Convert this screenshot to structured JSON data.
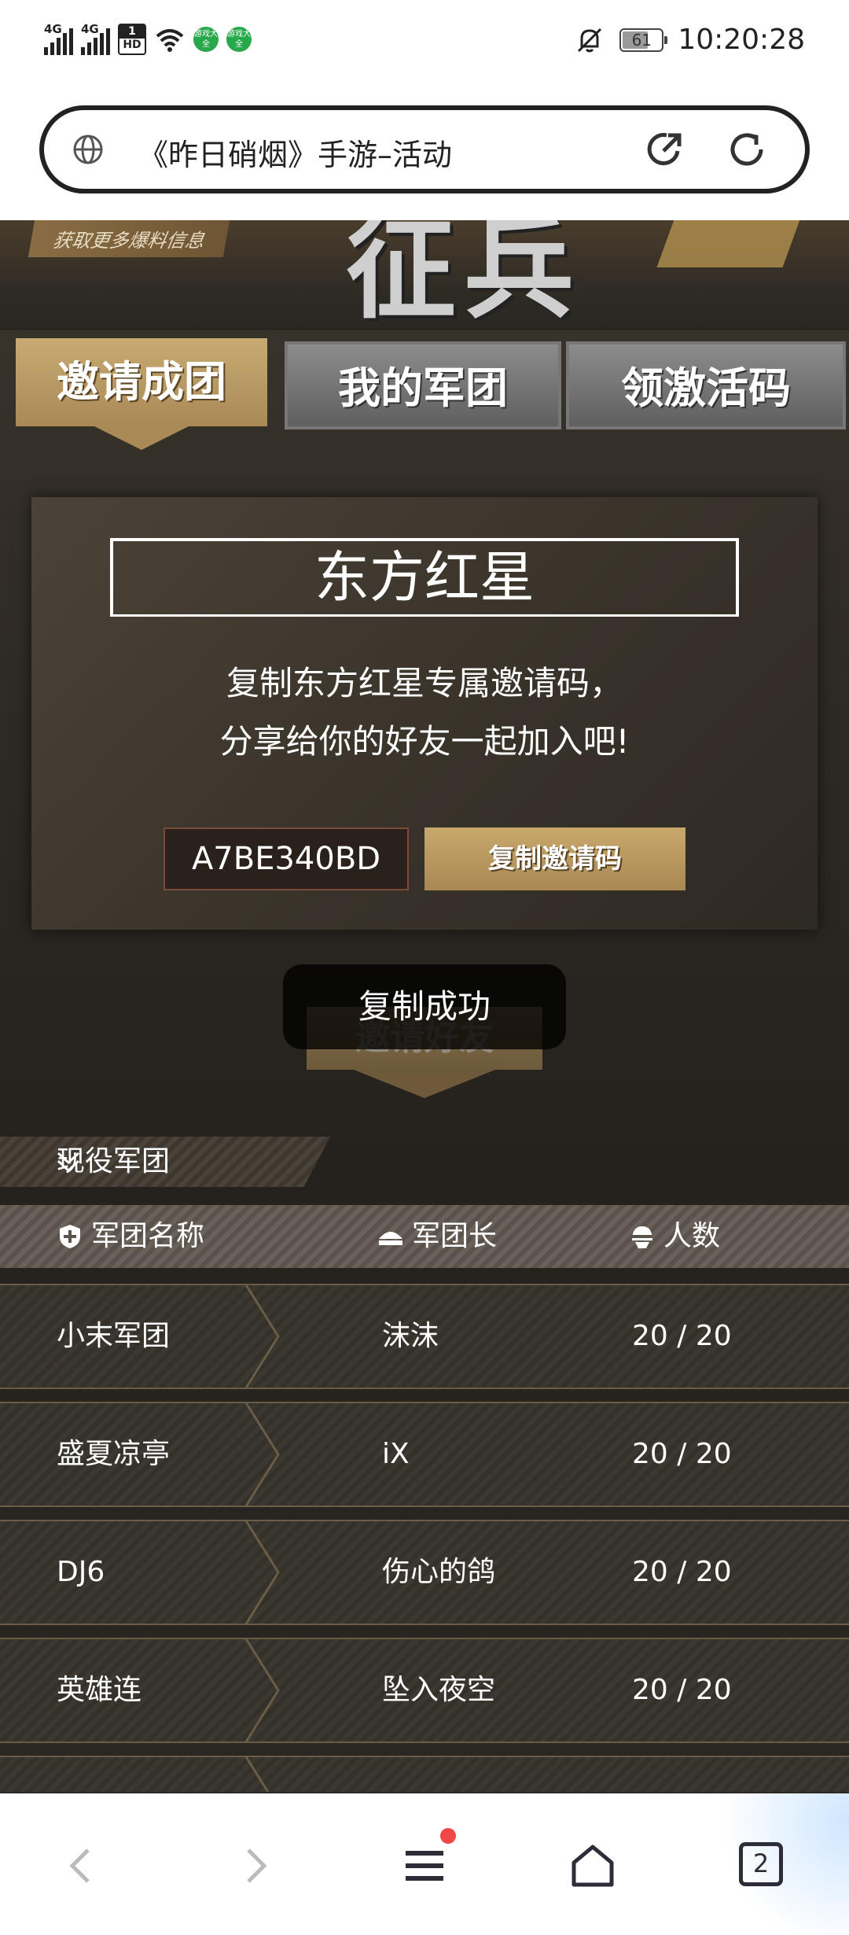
{
  "status_bar": {
    "signal1": "4G",
    "signal2": "4G",
    "hd": "HD",
    "sim_num": "1",
    "badge1": "游戏大全",
    "badge2": "游戏大全",
    "battery": "61",
    "time": "10:20:28"
  },
  "browser": {
    "page_title": "《昨日硝烟》手游–活动",
    "tab_count": "2"
  },
  "banner": {
    "tag": "获取更多爆料信息",
    "headline": "征兵"
  },
  "tabs": [
    {
      "label": "邀请成团",
      "active": true
    },
    {
      "label": "我的军团",
      "active": false
    },
    {
      "label": "领激活码",
      "active": false
    }
  ],
  "invite_card": {
    "title": "东方红星",
    "desc_line1": "复制东方红星专属邀请码，",
    "desc_line2": "分享给你的好友一起加入吧!",
    "code": "A7BE340BD",
    "copy_button": "复制邀请码"
  },
  "invite_friends_button": "邀请好友",
  "toast": "复制成功",
  "active_legions": {
    "section_label": "现役军团",
    "columns": [
      "军团名称",
      "军团长",
      "人数"
    ],
    "rows": [
      {
        "name": "小末军团",
        "leader": "沫沫",
        "members": "20 / 20"
      },
      {
        "name": "盛夏凉亭",
        "leader": "iX",
        "members": "20 / 20"
      },
      {
        "name": "DJ6",
        "leader": "伤心的鸽",
        "members": "20 / 20"
      },
      {
        "name": "英雄连",
        "leader": "坠入夜空",
        "members": "20 / 20"
      }
    ]
  },
  "colors": {
    "gold": "#b3914f",
    "background": "#2b2823",
    "notification_dot": "#f04848"
  }
}
